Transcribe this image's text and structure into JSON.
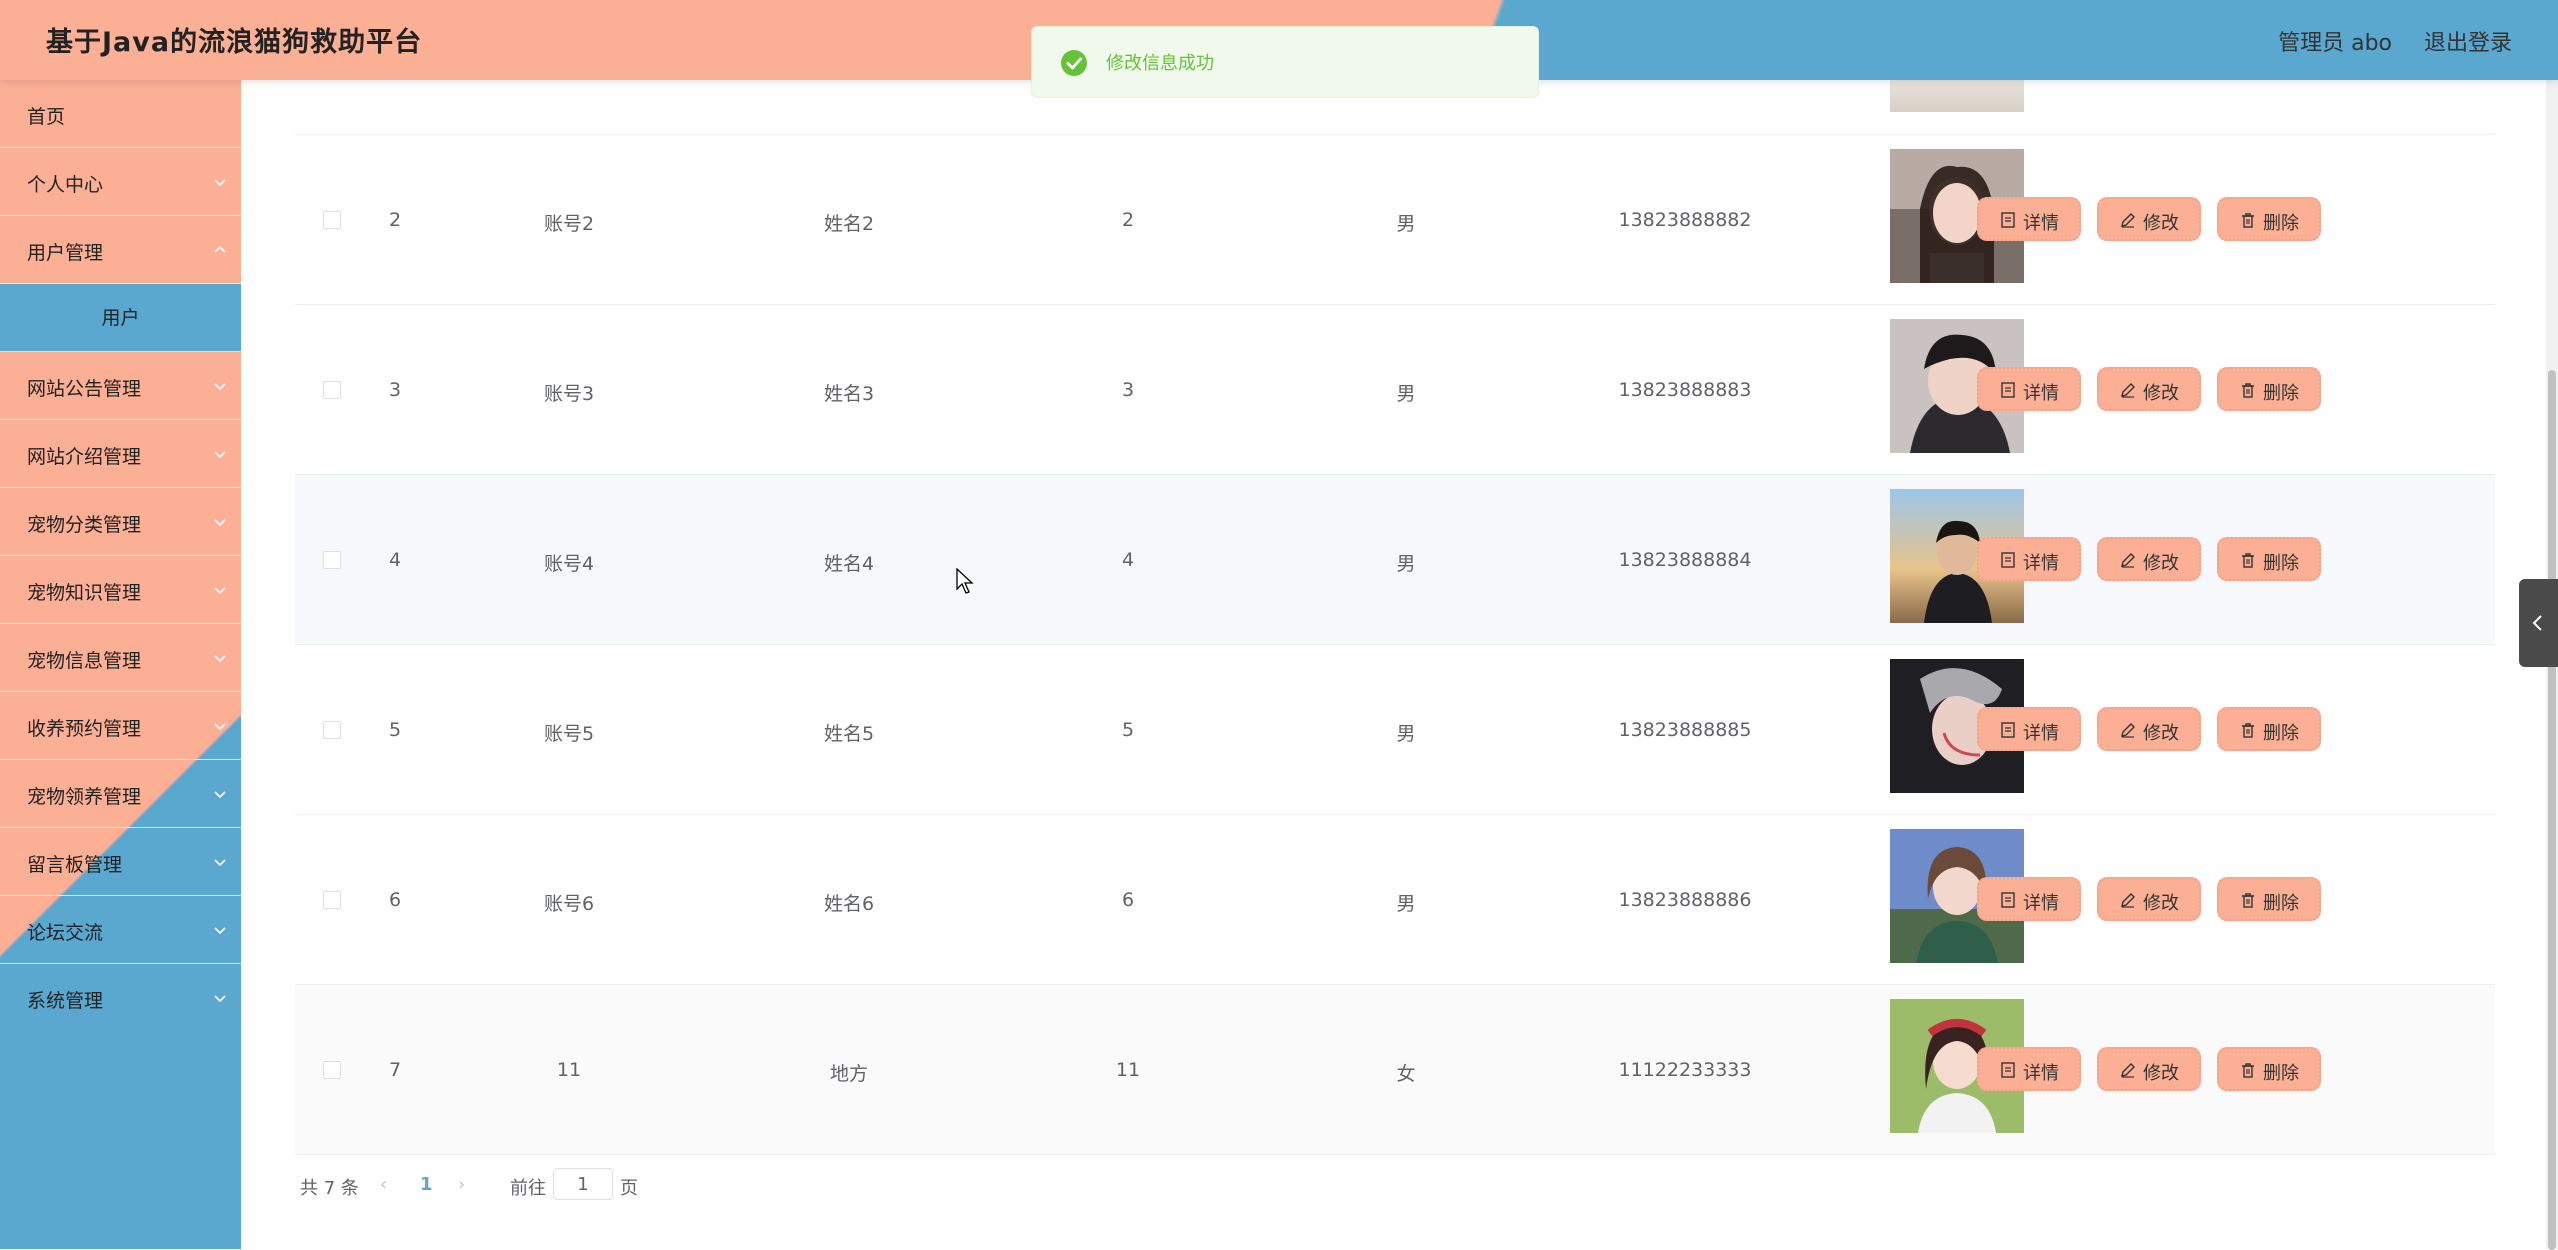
{
  "header": {
    "title": "基于Java的流浪猫狗救助平台",
    "admin": "管理员 abo",
    "logout": "退出登录"
  },
  "toast": {
    "message": "修改信息成功"
  },
  "sidebar": {
    "items": [
      {
        "label": "首页",
        "expandable": false
      },
      {
        "label": "个人中心",
        "expandable": true
      },
      {
        "label": "用户管理",
        "expandable": true
      },
      {
        "label": "用户",
        "expandable": false,
        "submenu": true
      },
      {
        "label": "网站公告管理",
        "expandable": true
      },
      {
        "label": "网站介绍管理",
        "expandable": true
      },
      {
        "label": "宠物分类管理",
        "expandable": true
      },
      {
        "label": "宠物知识管理",
        "expandable": true
      },
      {
        "label": "宠物信息管理",
        "expandable": true
      },
      {
        "label": "收养预约管理",
        "expandable": true
      },
      {
        "label": "宠物领养管理",
        "expandable": true
      },
      {
        "label": "留言板管理",
        "expandable": true
      },
      {
        "label": "论坛交流",
        "expandable": true
      },
      {
        "label": "系统管理",
        "expandable": true
      }
    ]
  },
  "table": {
    "rows": [
      {
        "index": "2",
        "account": "账号2",
        "name": "姓名2",
        "age": "2",
        "gender": "男",
        "phone": "13823888882"
      },
      {
        "index": "3",
        "account": "账号3",
        "name": "姓名3",
        "age": "3",
        "gender": "男",
        "phone": "13823888883"
      },
      {
        "index": "4",
        "account": "账号4",
        "name": "姓名4",
        "age": "4",
        "gender": "男",
        "phone": "13823888884"
      },
      {
        "index": "5",
        "account": "账号5",
        "name": "姓名5",
        "age": "5",
        "gender": "男",
        "phone": "13823888885"
      },
      {
        "index": "6",
        "account": "账号6",
        "name": "姓名6",
        "age": "6",
        "gender": "男",
        "phone": "13823888886"
      },
      {
        "index": "7",
        "account": "11",
        "name": "地方",
        "age": "11",
        "gender": "女",
        "phone": "11122233333"
      }
    ],
    "actions": {
      "detail": "详情",
      "edit": "修改",
      "delete": "删除"
    }
  },
  "pagination": {
    "total": "共 7 条",
    "current_page": "1",
    "goto_label": "前往",
    "goto_value": "1",
    "page_suffix": "页"
  },
  "colors": {
    "accent_salmon": "#fbb096",
    "accent_blue": "#5aa7d0",
    "success_green": "#67c23a"
  }
}
